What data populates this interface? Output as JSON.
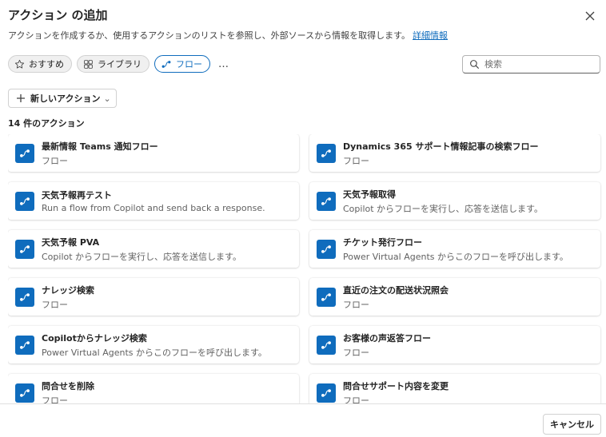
{
  "dialog": {
    "title": "アクション の追加",
    "description": "アクションを作成するか、使用するアクションのリストを参照し、外部ソースから情報を取得します。",
    "learn_more": "詳細情報"
  },
  "filters": {
    "chips": [
      {
        "label": "おすすめ",
        "icon": "star-icon",
        "active": false
      },
      {
        "label": "ライブラリ",
        "icon": "library-icon",
        "active": false
      },
      {
        "label": "フロー",
        "icon": "flow-icon",
        "active": true
      }
    ],
    "more": "…"
  },
  "search": {
    "placeholder": "検索",
    "value": ""
  },
  "new_action": {
    "label": "新しいアクション",
    "chevron": "⌄"
  },
  "count_label": "14 件のアクション",
  "actions": [
    {
      "name": "最新情報 Teams 通知フロー",
      "description": "フロー"
    },
    {
      "name": "Dynamics 365 サポート情報記事の検索フロー",
      "description": "フロー"
    },
    {
      "name": "天気予報再テスト",
      "description": "Run a flow from Copilot and send back a response."
    },
    {
      "name": "天気予報取得",
      "description": "Copilot からフローを実行し、応答を送信します。"
    },
    {
      "name": "天気予報 PVA",
      "description": "Copilot からフローを実行し、応答を送信します。"
    },
    {
      "name": "チケット発行フロー",
      "description": "Power Virtual Agents からこのフローを呼び出します。"
    },
    {
      "name": "ナレッジ検索",
      "description": "フロー"
    },
    {
      "name": "直近の注文の配送状況照会",
      "description": "フロー"
    },
    {
      "name": "Copilotからナレッジ検索",
      "description": "Power Virtual Agents からこのフローを呼び出します。"
    },
    {
      "name": "お客様の声返答フロー",
      "description": "フロー"
    },
    {
      "name": "問合せを削除",
      "description": "フロー"
    },
    {
      "name": "問合せサポート内容を変更",
      "description": "フロー"
    }
  ],
  "footer": {
    "cancel_label": "キャンセル"
  },
  "colors": {
    "accent": "#0f6cbd",
    "link": "#0f6cbd"
  }
}
